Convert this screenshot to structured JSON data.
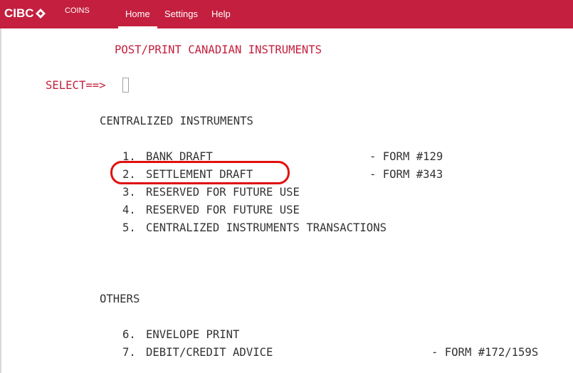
{
  "header": {
    "logo_text": "CIBC",
    "app_name": "COINS",
    "nav": [
      {
        "label": "Home",
        "active": true
      },
      {
        "label": "Settings",
        "active": false
      },
      {
        "label": "Help",
        "active": false
      }
    ],
    "brand_color": "#c41f3e"
  },
  "screen": {
    "title": "POST/PRINT CANADIAN INSTRUMENTS",
    "select_prompt": "SELECT==>",
    "select_value": "",
    "sections": [
      {
        "heading": "CENTRALIZED INSTRUMENTS",
        "items": [
          {
            "number": "1.",
            "label": "BANK DRAFT",
            "form": "- FORM #129"
          },
          {
            "number": "2.",
            "label": "SETTLEMENT DRAFT",
            "form": "- FORM #343",
            "highlighted": true
          },
          {
            "number": "3.",
            "label": "RESERVED FOR FUTURE USE",
            "form": ""
          },
          {
            "number": "4.",
            "label": "RESERVED FOR FUTURE USE",
            "form": ""
          },
          {
            "number": "5.",
            "label": "CENTRALIZED INSTRUMENTS TRANSACTIONS",
            "form": ""
          }
        ]
      },
      {
        "heading": "OTHERS",
        "items": [
          {
            "number": "6.",
            "label": "ENVELOPE PRINT",
            "form": ""
          },
          {
            "number": "7.",
            "label": "DEBIT/CREDIT ADVICE",
            "form": "- FORM #172/159S"
          }
        ]
      }
    ],
    "annotation_color": "#e01010"
  }
}
